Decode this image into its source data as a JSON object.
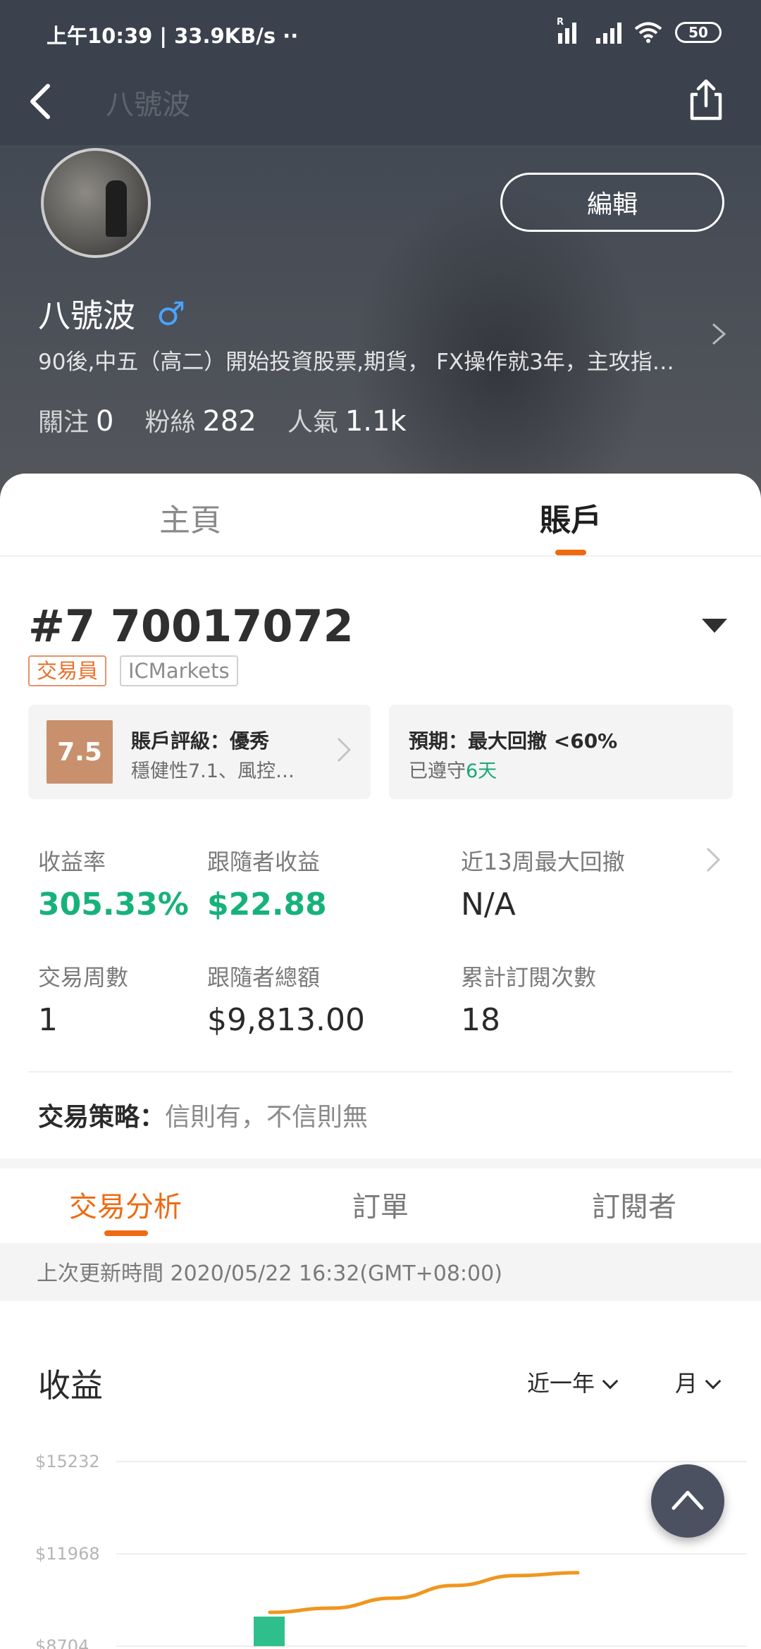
{
  "status_bar": {
    "time": "上午10:39 | 33.9KB/s  ··",
    "battery": "50",
    "sim_label": "R"
  },
  "nav": {
    "title": "八號波"
  },
  "profile": {
    "name": "八號波",
    "gender_symbol": "♂",
    "edit_label": "編輯",
    "bio": "90後,中五（高二）開始投資股票,期貨， FX操作就3年，主攻指…",
    "stats": [
      {
        "label": "關注",
        "value": "0"
      },
      {
        "label": "粉絲",
        "value": "282"
      },
      {
        "label": "人氣",
        "value": "1.1k"
      }
    ]
  },
  "tabs": {
    "home": "主頁",
    "account": "賬戶",
    "active": "賬戶"
  },
  "account": {
    "title": "#7 70017072",
    "tag_trader": "交易員",
    "tag_broker": "ICMarkets",
    "rating": {
      "score": "7.5",
      "title": "賬戶評級：優秀",
      "sub": "穩健性7.1、風控…"
    },
    "expect": {
      "title": "預期：最大回撤 <60%",
      "sub_prefix": "已遵守",
      "days": "6天"
    },
    "metrics": [
      {
        "label": "收益率",
        "value": "305.33%"
      },
      {
        "label": "跟隨者收益",
        "value": "$22.88"
      },
      {
        "label": "近13周最大回撤",
        "value": "N/A"
      },
      {
        "label": "交易周數",
        "value": "1"
      },
      {
        "label": "跟隨者總額",
        "value": "$9,813.00"
      },
      {
        "label": "累計訂閱次數",
        "value": "18"
      }
    ],
    "strategy_label": "交易策略：",
    "strategy_value": "信則有，不信則無"
  },
  "sub_tabs": {
    "analysis": "交易分析",
    "orders": "訂單",
    "subscribers": "訂閱者",
    "active": "交易分析"
  },
  "update_text": "上次更新時間 2020/05/22 16:32(GMT+08:00)",
  "profit": {
    "title": "收益",
    "range": "近一年",
    "period": "月"
  },
  "colors": {
    "accent": "#ef6a12",
    "positive": "#17b27a",
    "line": "#f0961e",
    "bar": "#2fbf8c",
    "header": "#3b424d"
  },
  "chart_data": {
    "type": "line",
    "y_ticks": [
      "$15232",
      "$11968",
      "$8704"
    ],
    "ylim": [
      8704,
      15232
    ],
    "bars": [
      {
        "index": 0,
        "value": 8704
      }
    ],
    "series": [
      {
        "values": [
          9900,
          10050,
          10400,
          10850,
          11200,
          11300
        ]
      }
    ]
  }
}
